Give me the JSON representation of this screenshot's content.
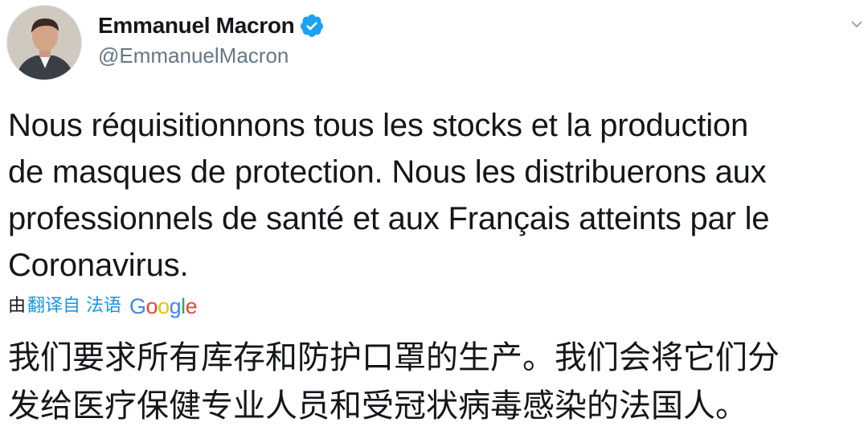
{
  "author": {
    "display_name": "Emmanuel Macron",
    "handle": "@EmmanuelMacron",
    "verified": true,
    "avatar_icon": "profile-photo"
  },
  "tweet": {
    "lines": [
      "Nous réquisitionnons tous les stocks et la production",
      "de masques de protection. Nous les distribuerons aux",
      "professionnels de santé et aux Français atteints par le",
      "Coronavirus."
    ]
  },
  "translation": {
    "prefix": "由",
    "link_text": "翻译自 法语",
    "provider_letters": [
      "G",
      "o",
      "o",
      "g",
      "l",
      "e"
    ],
    "provider_colors": [
      "#4285f4",
      "#ea4335",
      "#fbbc05",
      "#4285f4",
      "#34a853",
      "#ea4335"
    ],
    "lines": [
      "我们要求所有库存和防护口罩的生产。我们会将它们分",
      "发给医疗保健专业人员和受冠状病毒感染的法国人。"
    ]
  },
  "colors": {
    "verified_badge": "#1da1f2",
    "link": "#1b95e0",
    "handle": "#657786"
  }
}
